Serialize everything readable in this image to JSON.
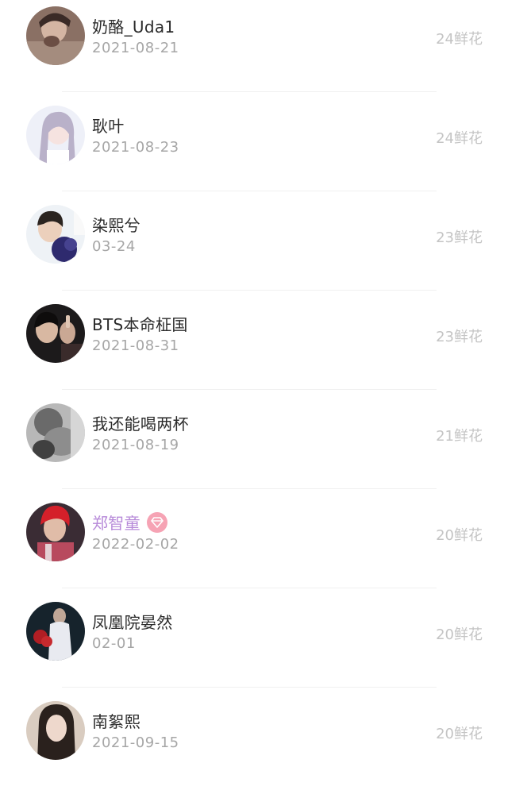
{
  "items": [
    {
      "name": "奶酪_Uda1",
      "date": "2021-08-21",
      "flowers": "24鲜花",
      "vip": false,
      "avatar_icon": "avatar-photo"
    },
    {
      "name": "耿叶",
      "date": "2021-08-23",
      "flowers": "24鲜花",
      "vip": false,
      "avatar_icon": "avatar-photo"
    },
    {
      "name": "染熙兮",
      "date": "03-24",
      "flowers": "23鲜花",
      "vip": false,
      "avatar_icon": "avatar-photo"
    },
    {
      "name": "BTS本命柾国",
      "date": "2021-08-31",
      "flowers": "23鲜花",
      "vip": false,
      "avatar_icon": "avatar-photo"
    },
    {
      "name": "我还能喝两杯",
      "date": "2021-08-19",
      "flowers": "21鲜花",
      "vip": false,
      "avatar_icon": "avatar-photo"
    },
    {
      "name": "郑智童",
      "date": "2022-02-02",
      "flowers": "20鲜花",
      "vip": true,
      "badge_icon": "diamond-icon",
      "avatar_icon": "avatar-photo"
    },
    {
      "name": "凤凰院晏然",
      "date": "02-01",
      "flowers": "20鲜花",
      "vip": false,
      "avatar_icon": "avatar-photo"
    },
    {
      "name": "南絮熙",
      "date": "2021-09-15",
      "flowers": "20鲜花",
      "vip": false,
      "avatar_icon": "avatar-photo"
    }
  ],
  "colors": {
    "name": "#2a2a2a",
    "vip_name": "#b78ad9",
    "date": "#a6a6a6",
    "flowers": "#c4c4c4",
    "vip_badge": "#f6a3b4",
    "divider": "#f0f0f0"
  }
}
